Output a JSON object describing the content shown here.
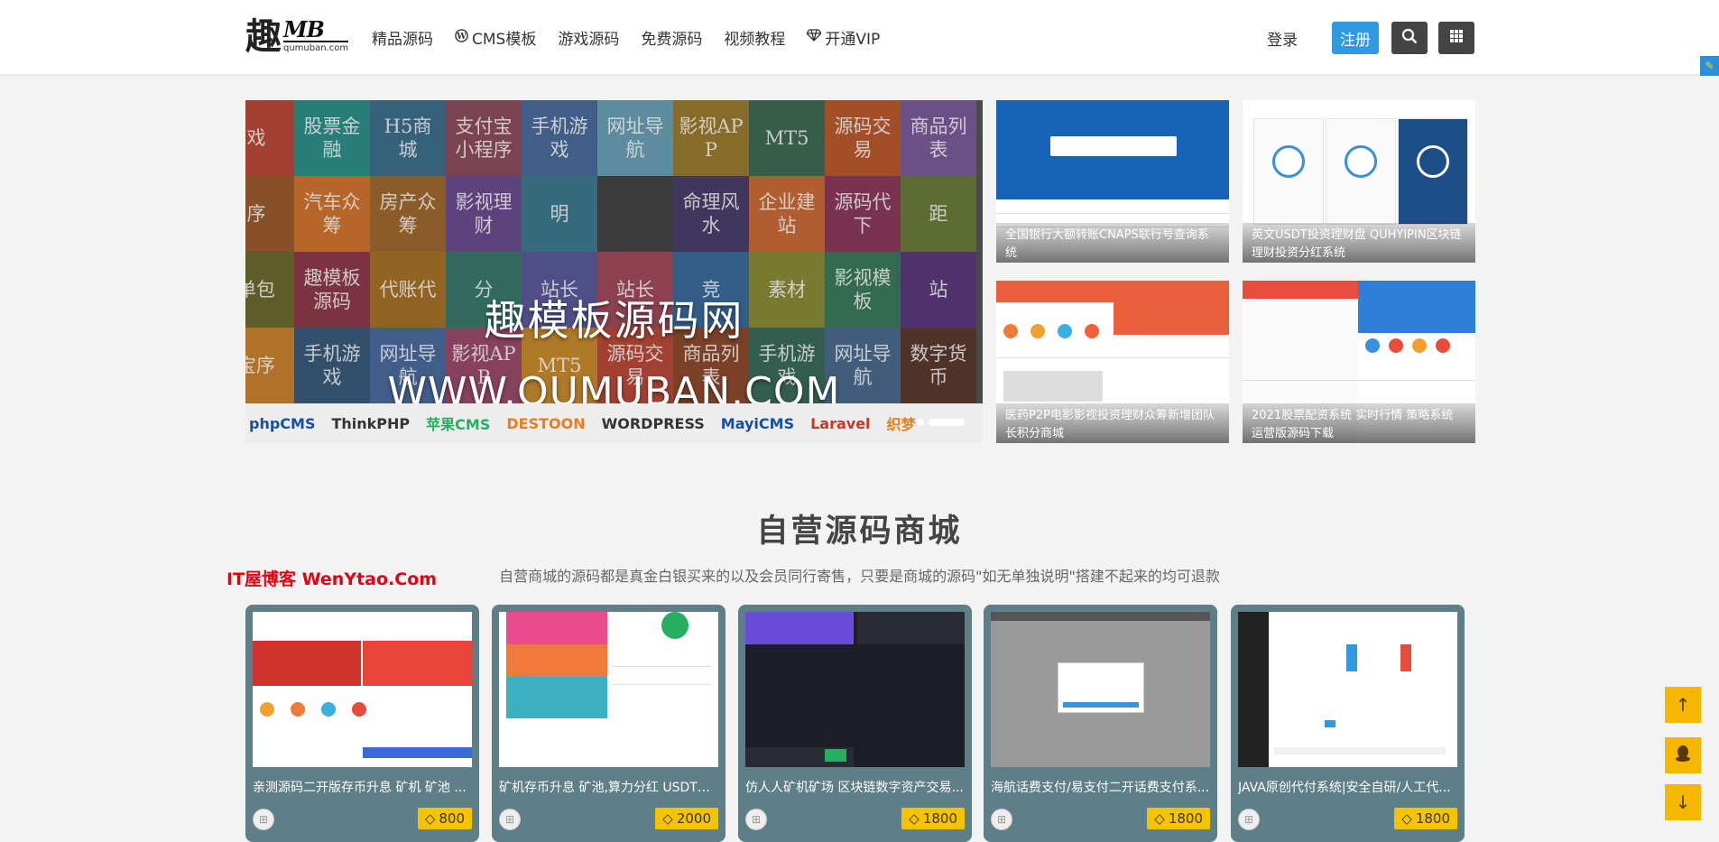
{
  "header": {
    "logo_char": "趣",
    "logo_mark": "MB",
    "logo_domain": "qumuban.com",
    "nav": [
      {
        "label": "精品源码",
        "icon": ""
      },
      {
        "label": "CMS模板",
        "icon": "wordpress-icon"
      },
      {
        "label": "游戏源码",
        "icon": ""
      },
      {
        "label": "免费源码",
        "icon": ""
      },
      {
        "label": "视频教程",
        "icon": ""
      },
      {
        "label": "开通VIP",
        "icon": "diamond-icon"
      }
    ],
    "login": "登录",
    "register": "注册"
  },
  "banner": {
    "title": "趣模板源码网",
    "domain": "WWW.QUMUBAN.COM",
    "tiles": [
      "戏",
      "股票金融",
      "H5商城",
      "支付宝小程序",
      "手机游戏",
      "网址导航",
      "影视APP",
      "MT5",
      "源码交易",
      "商品列表",
      "序",
      "汽车众筹",
      "房产众筹",
      "影视理财",
      "明",
      "",
      "命理风水",
      "企业建站",
      "源码代下",
      "距",
      "单包",
      "趣模板源码",
      "代账代",
      "分",
      "站长",
      "站长",
      "竞",
      "素材",
      "影视模板",
      "站",
      "宝序",
      "手机游戏",
      "网址导航",
      "影视APP",
      "MT5",
      "源码交易",
      "商品列表",
      "手机游戏",
      "网址导航",
      "数字货币"
    ],
    "tile_colors": [
      "#b94a3a",
      "#2f8f8a",
      "#3d6f8c",
      "#8c4c5e",
      "#4a6c9c",
      "#6aa0b5",
      "#9a7a2e",
      "#3f6a55",
      "#b95a2e",
      "#7a5a9a",
      "#9a5c2e",
      "#d0752e",
      "#a0692e",
      "#6a4c8c",
      "#3d7a8c",
      "#444",
      "#4a3e6a",
      "#c96a3a",
      "#8a3a5c",
      "#6a7c3a",
      "#6c6a2e",
      "#8c3a4a",
      "#a5722a",
      "#3a7a6a",
      "#5a5a9a",
      "#a04a5c",
      "#3a6a9a",
      "#8a8a3a",
      "#3a7a5a",
      "#5a3a7a",
      "#c9822e",
      "#3a5a7a",
      "#4a6a9c",
      "#9a4a6a",
      "#c88a2e",
      "#b94a3a",
      "#8c4a2e",
      "#3a6a5a",
      "#4a6a8c",
      "#5a3a2e"
    ],
    "strip_logos": [
      "phpCMS",
      "ThinkPHP",
      "苹果CMS",
      "DESTOON",
      "WORDPRESS",
      "MayiCMS",
      "Laravel",
      "织梦"
    ]
  },
  "features": [
    {
      "caption": "全国银行大额转账CNAPS联行号查询系统"
    },
    {
      "caption": "英文USDT投资理财盘 QUHYIPIN区块链理财投资分红系统"
    },
    {
      "caption": "医药P2P电影影视投资理财众筹新增团队长积分商城"
    },
    {
      "caption": "2021股票配资系统 实时行情 策略系统 运营版源码下载"
    }
  ],
  "section": {
    "title": "自营源码商城",
    "desc": "自营商城的源码都是真金白银买来的以及会员同行寄售，只要是商城的源码\"如无单独说明\"搭建不起来的均可退款",
    "watermark": "IT屋博客  WenYtao.Com"
  },
  "products": [
    {
      "title": "亲测源码二开版存币升息 矿机 矿池 ...",
      "price": "800"
    },
    {
      "title": "矿机存币升息 矿池,算力分红 USDT区...",
      "price": "2000"
    },
    {
      "title": "仿人人矿机矿场 区块链数字资产交易...",
      "price": "1800"
    },
    {
      "title": "海航话费支付/易支付二开话费支付系...",
      "price": "1800"
    },
    {
      "title": "JAVA原创代付系统|安全自研/人工代...",
      "price": "1800"
    }
  ],
  "float_buttons": {
    "top": "↑",
    "down": "↓"
  }
}
